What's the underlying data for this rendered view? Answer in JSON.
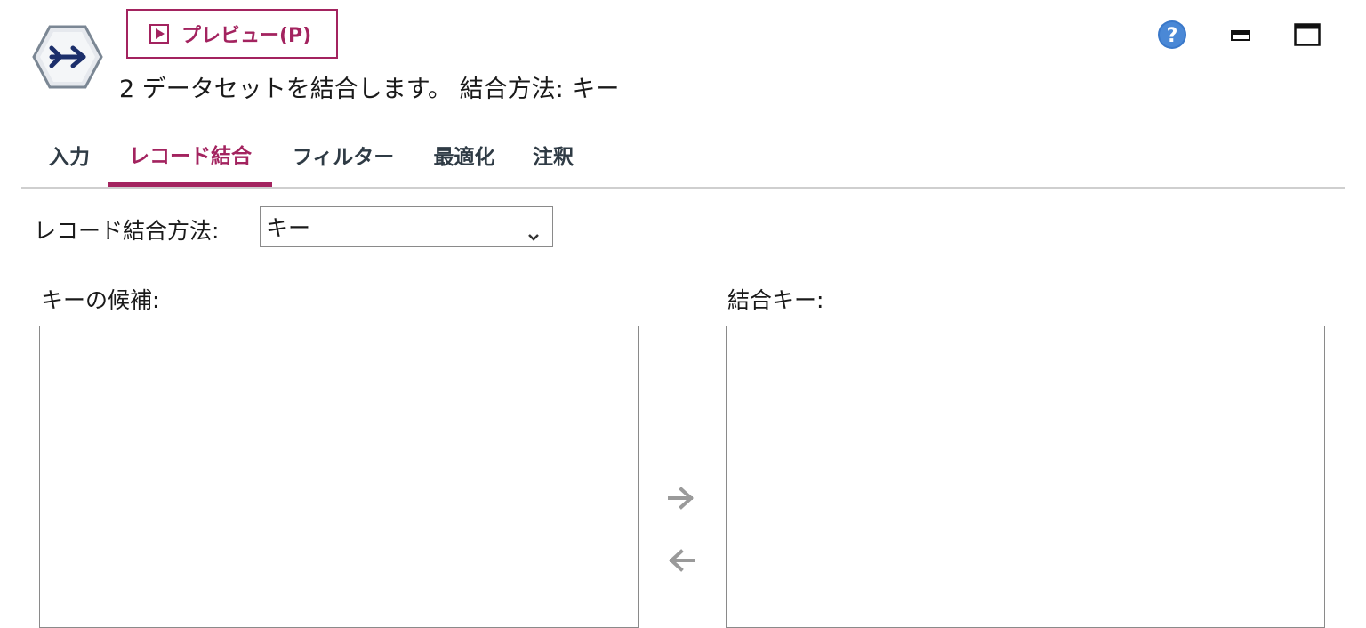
{
  "header": {
    "node_icon": "merge-node-icon",
    "preview_label": "プレビュー(P)",
    "subtitle": "2 データセットを結合します。 結合方法: キー"
  },
  "window_controls": {
    "help_icon": "help-icon",
    "minimize_icon": "minimize-icon",
    "maximize_icon": "maximize-icon"
  },
  "tabs": [
    {
      "label": "入力"
    },
    {
      "label": "レコード結合",
      "active": true
    },
    {
      "label": "フィルター"
    },
    {
      "label": "最適化"
    },
    {
      "label": "注釈"
    }
  ],
  "merge": {
    "method_label": "レコード結合方法:",
    "method_value": "キー",
    "candidates_label": "キーの候補:",
    "keys_label": "結合キー:",
    "candidate_items": [],
    "key_items": []
  },
  "colors": {
    "accent": "#a3235f",
    "tab_text": "#2f3b45",
    "border": "#8a8a8a",
    "disabled_arrow": "#9a9a9a",
    "help_blue": "#3a78c9"
  }
}
